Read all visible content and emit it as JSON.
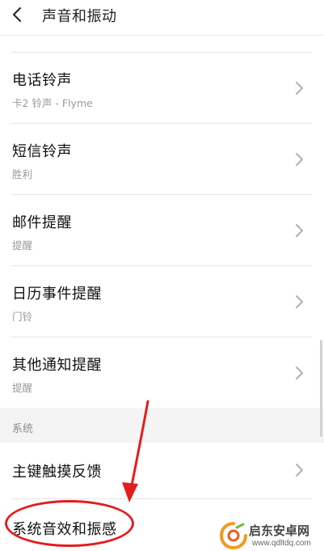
{
  "header": {
    "title": "声音和振动",
    "back_icon": "back-chevron-icon"
  },
  "rows": [
    {
      "title": "电话铃声",
      "subtitle": "卡2 铃声 - Flyme"
    },
    {
      "title": "短信铃声",
      "subtitle": "胜利"
    },
    {
      "title": "邮件提醒",
      "subtitle": "提醒"
    },
    {
      "title": "日历事件提醒",
      "subtitle": "门铃"
    },
    {
      "title": "其他通知提醒",
      "subtitle": "提醒"
    }
  ],
  "section": {
    "label": "系统"
  },
  "system_rows": [
    {
      "title": "主键触摸反馈"
    },
    {
      "title": "系统音效和振感"
    }
  ],
  "watermark": {
    "text": "启东安卓网",
    "url": "www.qdltdq.com"
  },
  "colors": {
    "annotation_red": "#e31d1d",
    "chevron_gray": "#b0b0b0",
    "watermark_orange": "#f39a1e"
  }
}
